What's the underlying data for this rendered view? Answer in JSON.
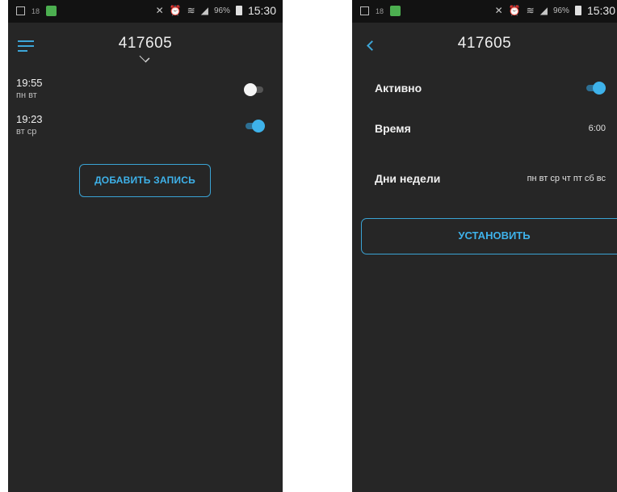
{
  "status_bar": {
    "notif_small": "18",
    "battery": "96%",
    "time": "15:30"
  },
  "left_screen": {
    "title": "417605",
    "alarms": [
      {
        "time": "19:55",
        "days": "пн вт",
        "enabled": false
      },
      {
        "time": "19:23",
        "days": "вт ср",
        "enabled": true
      }
    ],
    "add_button_label": "ДОБАВИТЬ ЗАПИСЬ"
  },
  "right_screen": {
    "title": "417605",
    "active_label": "Активно",
    "active_enabled": true,
    "time_label": "Время",
    "time_value": "6:00",
    "days_label": "Дни недели",
    "days_value": "пн вт ср чт пт сб вс",
    "set_button_label": "УСТАНОВИТЬ"
  },
  "colors": {
    "background": "#262626",
    "status_bar": "#121212",
    "accent": "#3eb2ea"
  },
  "icons": [
    "menu-icon",
    "chevron-down-icon",
    "back-icon",
    "alarm-clock-icon",
    "wifi-icon",
    "signal-icon",
    "battery-icon"
  ]
}
